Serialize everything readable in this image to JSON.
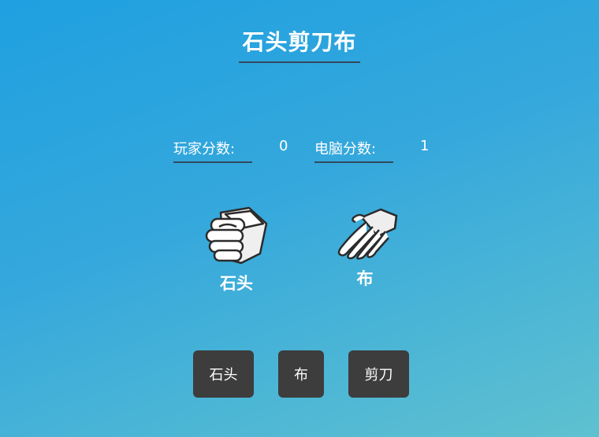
{
  "title": "石头剪刀布",
  "scores": {
    "player_label": "玩家分数:",
    "player_value": "0",
    "computer_label": "电脑分数:",
    "computer_value": "1"
  },
  "choices": {
    "player": {
      "icon": "rock-hand-icon",
      "label": "石头"
    },
    "computer": {
      "icon": "paper-hand-icon",
      "label": "布"
    }
  },
  "buttons": {
    "rock": "石头",
    "paper": "布",
    "scissors": "剪刀"
  },
  "colors": {
    "background_start": "#1fa0e0",
    "background_end": "#5fc1d0",
    "underline": "#34495e",
    "button": "#3d3d3d",
    "text": "#ffffff"
  }
}
